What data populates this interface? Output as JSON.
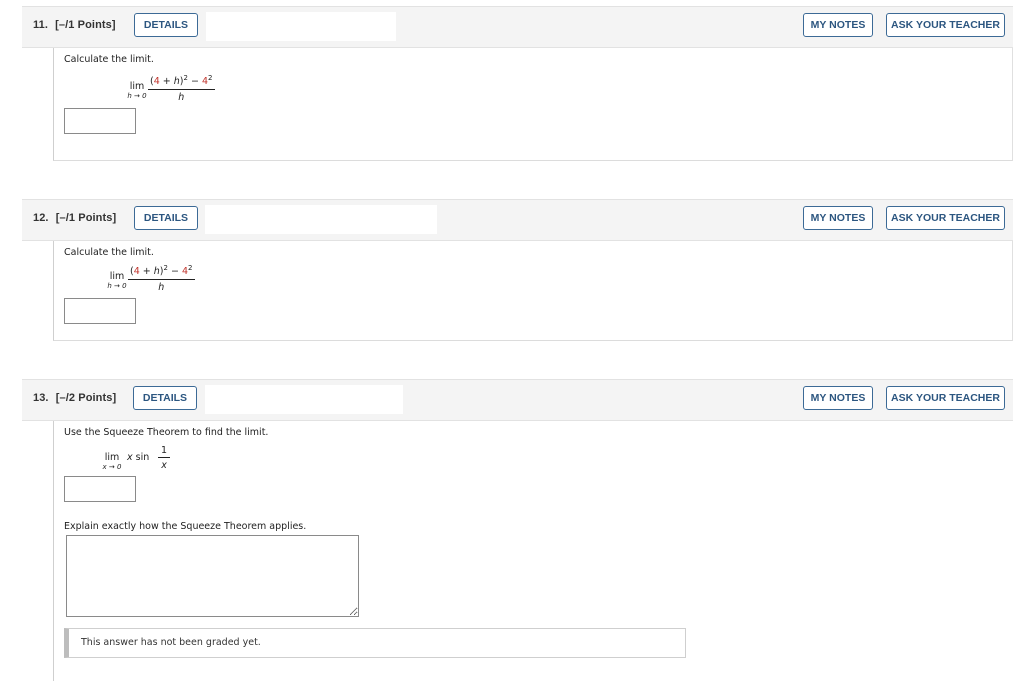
{
  "buttons": {
    "details": "DETAILS",
    "my_notes": "MY NOTES",
    "ask_teacher": "ASK YOUR TEACHER"
  },
  "questions": [
    {
      "number": "11.",
      "points": "[–/1 Points]",
      "prompt": "Calculate the limit.",
      "limit_word": "lim",
      "limit_sub": "h → 0",
      "numerator": {
        "open": "(",
        "a": "4",
        "plus": " + ",
        "var": "h",
        "close": ")",
        "exp1": "2",
        "minus": " − ",
        "b": "4",
        "exp2": "2"
      },
      "denominator": "h",
      "answer_value": ""
    },
    {
      "number": "12.",
      "points": "[–/1 Points]",
      "prompt": "Calculate the limit.",
      "limit_word": "lim",
      "limit_sub": "h → 0",
      "numerator": {
        "open": "(",
        "a": "4",
        "plus": " + ",
        "var": "h",
        "close": ")",
        "exp1": "2",
        "minus": " − ",
        "b": "4",
        "exp2": "2"
      },
      "denominator": "h",
      "answer_value": ""
    },
    {
      "number": "13.",
      "points": "[–/2 Points]",
      "prompt": "Use the Squeeze Theorem to find the limit.",
      "limit_word": "lim",
      "limit_sub": "x → 0",
      "expression_var": "x",
      "expression_fn": "sin",
      "frac_num": "1",
      "frac_den": "x",
      "answer_value": "",
      "explain_prompt": "Explain exactly how the Squeeze Theorem applies.",
      "explain_value": "",
      "graded_note": "This answer has not been graded yet."
    }
  ],
  "colors": {
    "accent": "#3c6a96",
    "highlight_red": "#c0332b",
    "header_bg": "#f4f4f4"
  }
}
